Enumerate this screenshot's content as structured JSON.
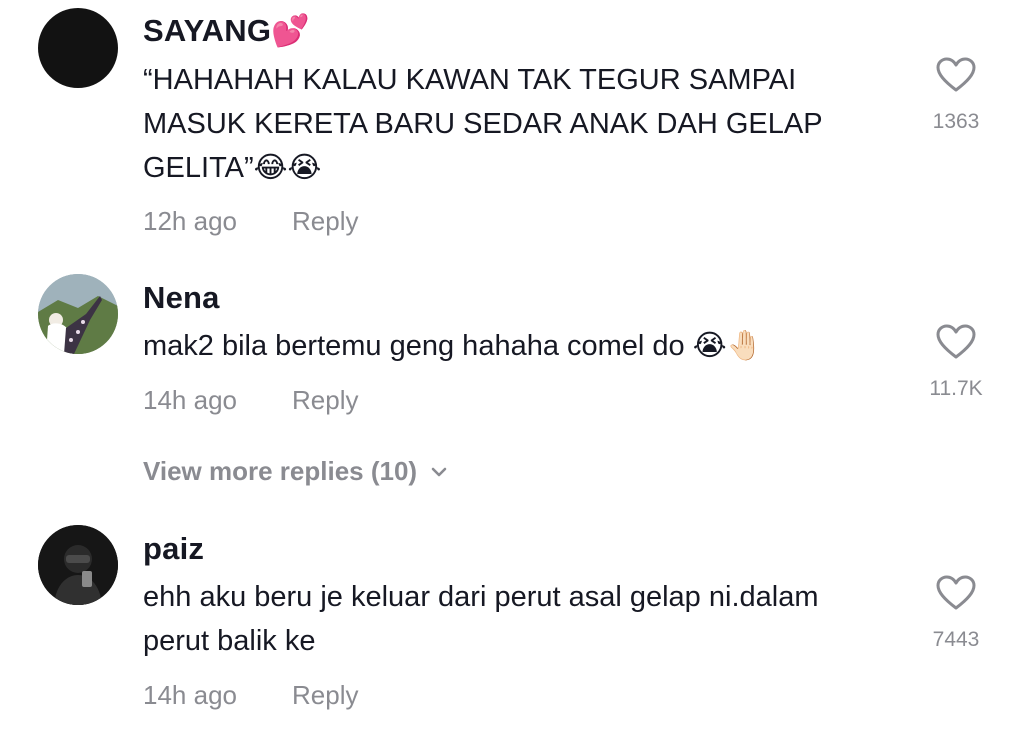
{
  "comments": [
    {
      "username": "SAYANG💕",
      "text": "“HAHAHAH KALAU KAWAN TAK TEGUR SAMPAI\nMASUK KERETA BARU SEDAR ANAK DAH GELAP\nGELITA”😂😭",
      "time": "12h ago",
      "reply_label": "Reply",
      "like_count": "1363",
      "avatar": "black-circle"
    },
    {
      "username": "Nena",
      "text": "mak2 bila bertemu geng hahaha comel do 😭🤚🏻",
      "time": "14h ago",
      "reply_label": "Reply",
      "like_count": "11.7K",
      "avatar": "photo"
    },
    {
      "username": "paiz",
      "text": "ehh aku beru je keluar dari perut asal gelap ni.dalam\nperut balik ke",
      "time": "14h ago",
      "reply_label": "Reply",
      "like_count": "7443",
      "avatar": "photo"
    }
  ],
  "view_more": {
    "label": "View more replies (10)",
    "icon": "chevron-down-icon"
  },
  "icons": {
    "like": "heart-outline-icon"
  },
  "colors": {
    "primary_text": "#161823",
    "secondary_text": "#8a8b91",
    "background": "#ffffff"
  }
}
